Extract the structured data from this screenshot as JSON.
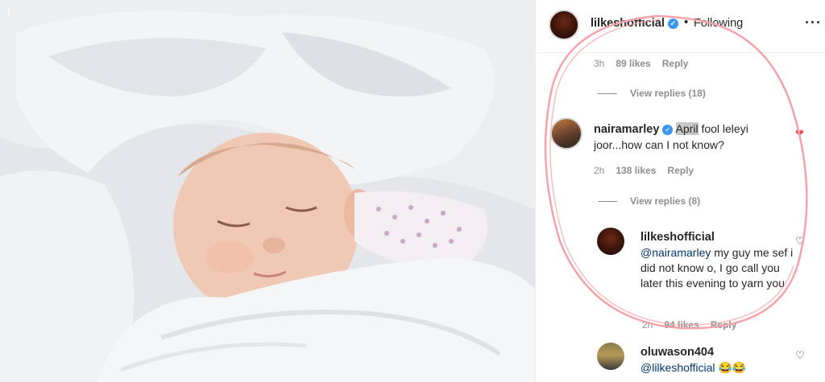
{
  "header": {
    "username": "lilkeshofficial",
    "verified_icon": "verified-badge-icon",
    "follow_status": "Following",
    "more_icon": "more-options-icon"
  },
  "photo": {
    "download_icon": "down-arrow-icon",
    "download_glyph": "↓"
  },
  "comments": {
    "top_meta": {
      "time": "3h",
      "likes": "89 likes",
      "reply": "Reply"
    },
    "top_view_replies": "View replies (18)",
    "naira": {
      "username": "nairamarley",
      "highlighted": "April",
      "text": " fool leleyi joor...how can I not know?",
      "time": "2h",
      "likes": "138 likes",
      "reply": "Reply",
      "view_replies": "View replies (8)",
      "liked": true
    },
    "lilkesh_reply": {
      "username": "lilkeshofficial",
      "mention": "@nairamarley",
      "text": " my guy me sef i did not know o, I go call you later this evening to yarn you",
      "time": "2h",
      "likes": "94 likes",
      "reply": "Reply"
    },
    "oluwason": {
      "username": "oluwason404",
      "mention": "@lilkeshofficial",
      "emojis": "😂😂"
    }
  },
  "colors": {
    "verified": "#3897f0",
    "like_red": "#ed4956",
    "annotation_circle": "#f4a3a8"
  }
}
